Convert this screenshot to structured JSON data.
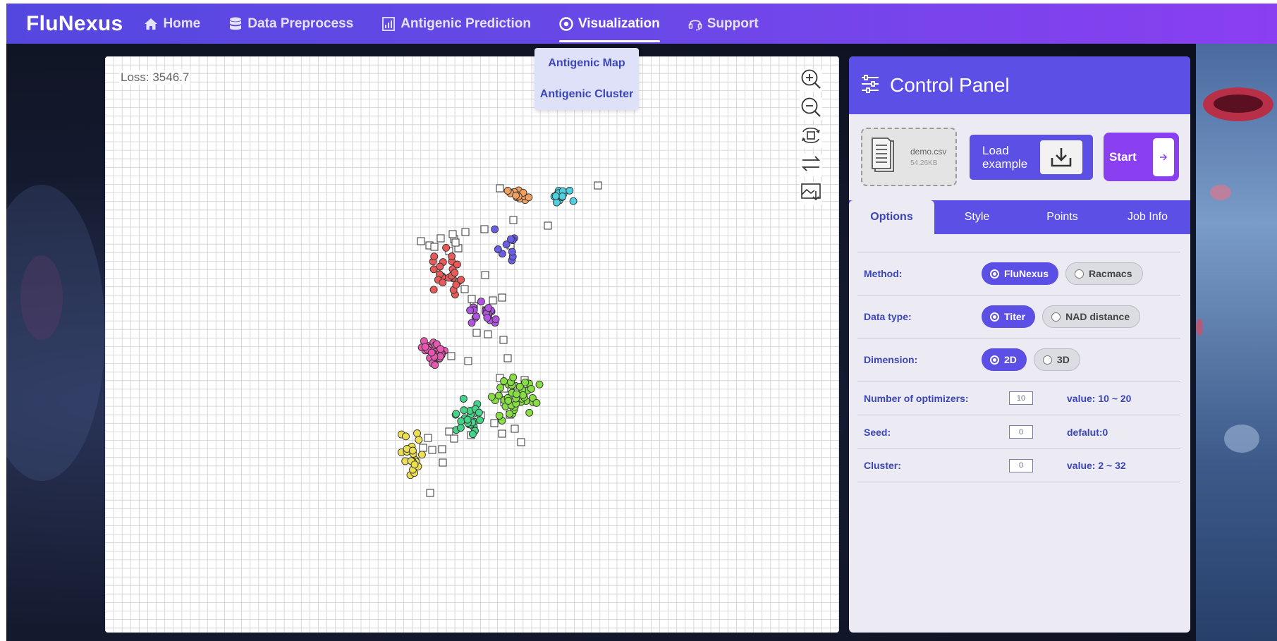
{
  "app": {
    "brand": "FluNexus"
  },
  "nav": {
    "items": [
      {
        "label": "Home",
        "icon": "home-icon"
      },
      {
        "label": "Data Preprocess",
        "icon": "database-icon"
      },
      {
        "label": "Antigenic Prediction",
        "icon": "chart-icon"
      },
      {
        "label": "Visualization",
        "icon": "eye-icon",
        "active": true
      },
      {
        "label": "Support",
        "icon": "headset-icon"
      }
    ],
    "dropdown": [
      "Antigenic Map",
      "Antigenic Cluster"
    ]
  },
  "map": {
    "loss_text": "Loss: 3546.7",
    "tools": [
      "zoom-in-icon",
      "zoom-out-icon",
      "rotate-icon",
      "flip-icon",
      "download-image-icon"
    ],
    "cluster_colors": {
      "orange": "#f0a060",
      "cyan": "#4fd0e0",
      "blue": "#6a5ee6",
      "red": "#e85a5a",
      "purple": "#b054e0",
      "pink": "#e858b0",
      "lime": "#88dd44",
      "green": "#44d488",
      "yellow": "#ece050"
    }
  },
  "panel": {
    "title": "Control Panel",
    "file": {
      "name": "demo.csv",
      "size": "54.26KB"
    },
    "load_example": "Load example",
    "start": "Start",
    "tabs": [
      "Options",
      "Style",
      "Points",
      "Job Info"
    ],
    "method": {
      "label": "Method:",
      "options": [
        "FluNexus",
        "Racmacs"
      ],
      "selected": "FluNexus"
    },
    "data_type": {
      "label": "Data type:",
      "options": [
        "Titer",
        "NAD distance"
      ],
      "selected": "Titer"
    },
    "dimension": {
      "label": "Dimension:",
      "options": [
        "2D",
        "3D"
      ],
      "selected": "2D"
    },
    "optimizers": {
      "label": "Number of optimizers:",
      "value": "10",
      "hint": "value: 10 ~ 20"
    },
    "seed": {
      "label": "Seed:",
      "value": "0",
      "hint": "defalut:0"
    },
    "cluster": {
      "label": "Cluster:",
      "value": "0",
      "hint": "value: 2 ~ 32"
    }
  },
  "colors": {
    "primary": "#5b4fe6",
    "accent": "#8a3ff0",
    "label": "#3b47b8"
  }
}
